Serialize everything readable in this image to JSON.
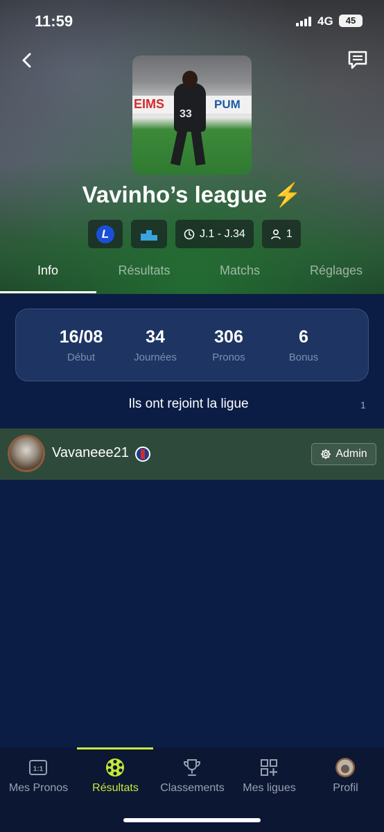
{
  "status": {
    "time": "11:59",
    "network": "4G",
    "battery": "45"
  },
  "league": {
    "title": "Vavinho’s league ⚡",
    "range": "J.1 - J.34",
    "members": "1",
    "ligue_logo": "L"
  },
  "tabs": [
    "Info",
    "Résultats",
    "Matchs",
    "Réglages"
  ],
  "stats": [
    {
      "value": "16/08",
      "label": "Début"
    },
    {
      "value": "34",
      "label": "Journées"
    },
    {
      "value": "306",
      "label": "Pronos"
    },
    {
      "value": "6",
      "label": "Bonus"
    }
  ],
  "joined": {
    "title": "Ils ont rejoint la ligue",
    "count": "1"
  },
  "member": {
    "name": "Vavaneee21",
    "role": "Admin"
  },
  "photo": {
    "ad_left": "EIMS",
    "ad_right": "PUM",
    "jersey_number": "33"
  },
  "nav": [
    "Mes Pronos",
    "Résultats",
    "Classements",
    "Mes ligues",
    "Profil"
  ],
  "colors": {
    "accent": "#c6e93a",
    "background": "#0b1d45",
    "member_row": "#2e4a3b"
  }
}
